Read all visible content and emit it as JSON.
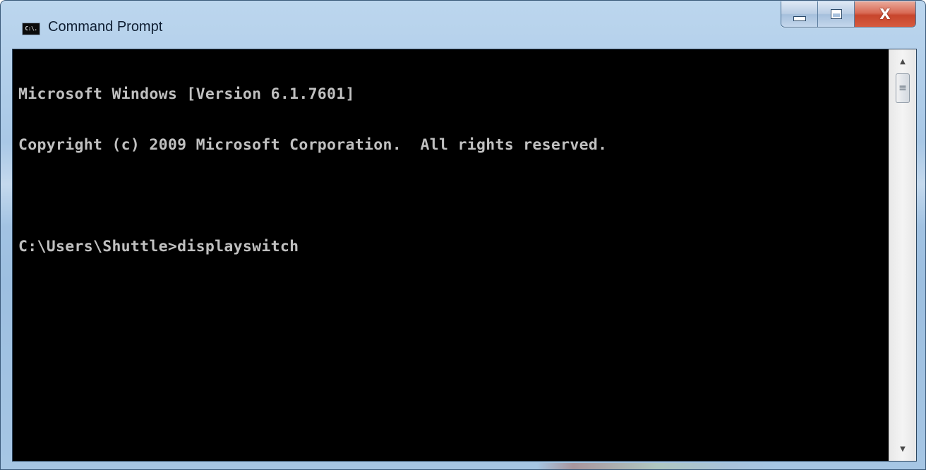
{
  "window": {
    "title": "Command Prompt",
    "icon_text": "C:\\.",
    "icon": "console-window-icon",
    "controls": {
      "minimize_icon": "minimize-icon",
      "maximize_icon": "maximize-icon",
      "close_label": "X"
    }
  },
  "console": {
    "lines": [
      "Microsoft Windows [Version 6.1.7601]",
      "Copyright (c) 2009 Microsoft Corporation.  All rights reserved.",
      "",
      "C:\\Users\\Shuttle>displayswitch"
    ],
    "text_color": "#c0c0c0",
    "background": "#000000"
  },
  "scrollbar": {
    "up_icon": "scroll-up-arrow-icon",
    "down_icon": "scroll-down-arrow-icon",
    "thumb_grip": "≡"
  },
  "colors": {
    "frame": "#a9c8e6",
    "close_button": "#c7452c"
  }
}
